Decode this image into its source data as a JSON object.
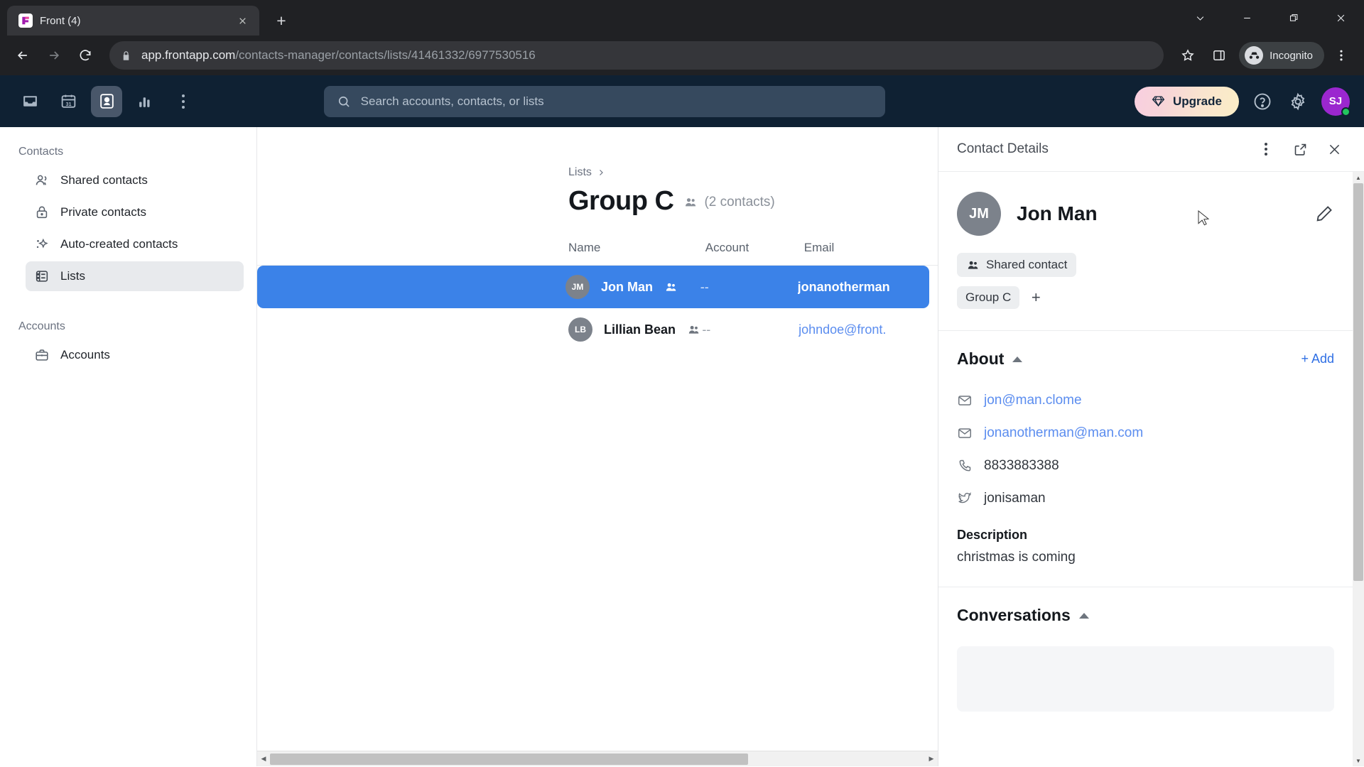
{
  "browser": {
    "tab": {
      "title": "Front (4)",
      "favicon_icon": "front-logo-icon",
      "close_icon": "close-icon"
    },
    "new_tab_label": "+",
    "window_controls": [
      {
        "name": "chevron-down-icon",
        "label": "⌄"
      },
      {
        "name": "minimize-icon",
        "label": "—"
      },
      {
        "name": "restore-icon",
        "label": "❐"
      },
      {
        "name": "close-window-icon",
        "label": "✕"
      }
    ],
    "nav": {
      "back_icon": "back-arrow-icon",
      "forward_icon": "forward-arrow-icon",
      "reload_icon": "reload-icon"
    },
    "omnibox": {
      "lock_icon": "lock-icon",
      "url_domain": "app.frontapp.com",
      "url_path": "/contacts-manager/contacts/lists/41461332/6977530516",
      "bookmark_icon": "star-icon",
      "sidepanel_icon": "side-panel-icon"
    },
    "incognito": {
      "label": "Incognito",
      "icon": "incognito-icon"
    },
    "menu_icon": "kebab-menu-icon"
  },
  "app_nav": {
    "icons": [
      {
        "name": "inbox-icon",
        "label": "Inbox",
        "active": false
      },
      {
        "name": "calendar-icon",
        "label": "Calendar",
        "active": false,
        "day": "31"
      },
      {
        "name": "contacts-icon",
        "label": "Contacts",
        "active": true
      },
      {
        "name": "analytics-icon",
        "label": "Analytics",
        "active": false
      },
      {
        "name": "more-icon",
        "label": "More",
        "active": false
      }
    ],
    "search_placeholder": "Search accounts, contacts, or lists",
    "search_value": "",
    "upgrade_label": "Upgrade",
    "help_label": "Help",
    "settings_label": "Settings",
    "avatar_initials": "SJ"
  },
  "sidebar": {
    "groups": [
      {
        "title": "Contacts",
        "items": [
          {
            "label": "Shared contacts",
            "icon": "people-icon",
            "active": false
          },
          {
            "label": "Private contacts",
            "icon": "lock-icon",
            "active": false
          },
          {
            "label": "Auto-created contacts",
            "icon": "sparkles-icon",
            "active": false
          },
          {
            "label": "Lists",
            "icon": "list-icon",
            "active": true
          }
        ]
      },
      {
        "title": "Accounts",
        "items": [
          {
            "label": "Accounts",
            "icon": "briefcase-icon",
            "active": false
          }
        ]
      }
    ]
  },
  "list_view": {
    "breadcrumb": "Lists",
    "breadcrumb_separator_icon": "chevron-right-icon",
    "title": "Group C",
    "count_label": "(2 contacts)",
    "group_icon": "people-filled-icon",
    "columns": [
      "Name",
      "Account",
      "Email"
    ],
    "rows": [
      {
        "initials": "JM",
        "name": "Jon Man",
        "shared_icon": "shared-contact-icon",
        "account": "--",
        "email": "jonanotherman",
        "selected": true
      },
      {
        "initials": "LB",
        "name": "Lillian Bean",
        "shared_icon": "shared-contact-icon",
        "account": "--",
        "email": "johndoe@front.",
        "selected": false
      }
    ]
  },
  "details": {
    "title": "Contact Details",
    "header_actions": [
      {
        "name": "kebab-menu-icon",
        "label": "More options"
      },
      {
        "name": "open-external-icon",
        "label": "Open in new window"
      },
      {
        "name": "close-icon",
        "label": "Close"
      }
    ],
    "contact": {
      "initials": "JM",
      "name": "Jon Man",
      "edit_icon": "pencil-icon",
      "shared_badge": "Shared contact",
      "shared_badge_icon": "shared-contact-icon",
      "tags": [
        "Group C"
      ],
      "tag_add_label": "+"
    },
    "about": {
      "title": "About",
      "collapse_icon": "caret-up-icon",
      "add_label": "+ Add",
      "fields": [
        {
          "icon": "email-icon",
          "value": "jon@man.clome",
          "type": "link"
        },
        {
          "icon": "email-icon",
          "value": "jonanotherman@man.com",
          "type": "link"
        },
        {
          "icon": "phone-icon",
          "value": "8833883388",
          "type": "text"
        },
        {
          "icon": "twitter-icon",
          "value": "jonisaman",
          "type": "text"
        }
      ],
      "description_label": "Description",
      "description_value": "christmas is coming"
    },
    "conversations": {
      "title": "Conversations",
      "collapse_icon": "caret-up-icon"
    }
  },
  "colors": {
    "app_nav_bg": "#0f2133",
    "selected_row": "#3b82e8",
    "link_blue": "#5b8def",
    "accent_blue": "#2f6fe4",
    "avatar_purple": "#9b27cf",
    "presence_green": "#22c55e"
  }
}
